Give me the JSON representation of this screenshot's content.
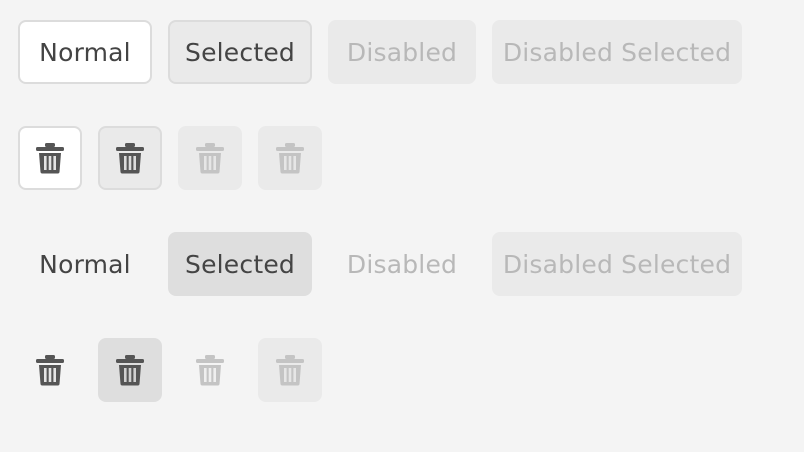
{
  "rows": {
    "bordered_text": {
      "normal": "Normal",
      "selected": "Selected",
      "disabled": "Disabled",
      "disabled_selected": "Disabled Selected"
    },
    "quiet_text": {
      "normal": "Normal",
      "selected": "Selected",
      "disabled": "Disabled",
      "disabled_selected": "Disabled Selected"
    }
  },
  "icons": {
    "delete": "trash-icon"
  },
  "colors": {
    "background": "#f4f4f4",
    "text_enabled": "#444444",
    "text_disabled": "#b8b8b8",
    "icon_enabled": "#555555",
    "icon_disabled": "#c4c4c4"
  }
}
